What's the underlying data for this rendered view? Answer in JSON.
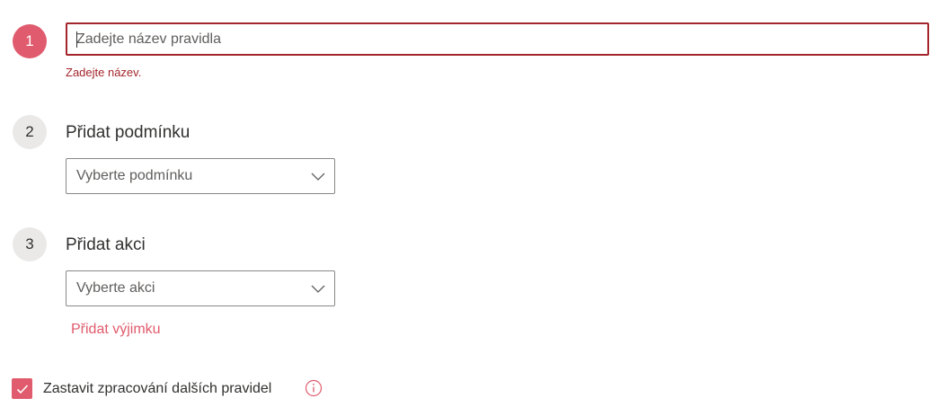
{
  "steps": {
    "step1": {
      "number": "1",
      "name_input": {
        "value": "",
        "placeholder": "Zadejte název pravidla"
      },
      "error": "Zadejte název."
    },
    "step2": {
      "number": "2",
      "title": "Přidat podmínku",
      "dropdown": {
        "selected": "Vyberte podmínku"
      }
    },
    "step3": {
      "number": "3",
      "title": "Přidat akci",
      "dropdown": {
        "selected": "Vyberte akci"
      },
      "exception_link": "Přidat výjimku"
    }
  },
  "stop_processing": {
    "label": "Zastavit zpracování dalších pravidel",
    "checked": true
  },
  "icons": {
    "dropdown_chevron": "chevron-down-icon",
    "checkbox_mark": "checkmark-icon",
    "info": "info-icon"
  },
  "colors": {
    "accent": "#e05b6d",
    "error": "#a4262c",
    "text": "#323130",
    "placeholder": "#605e5c",
    "inactive_step": "#ebe9e7",
    "border": "#8a8886"
  }
}
